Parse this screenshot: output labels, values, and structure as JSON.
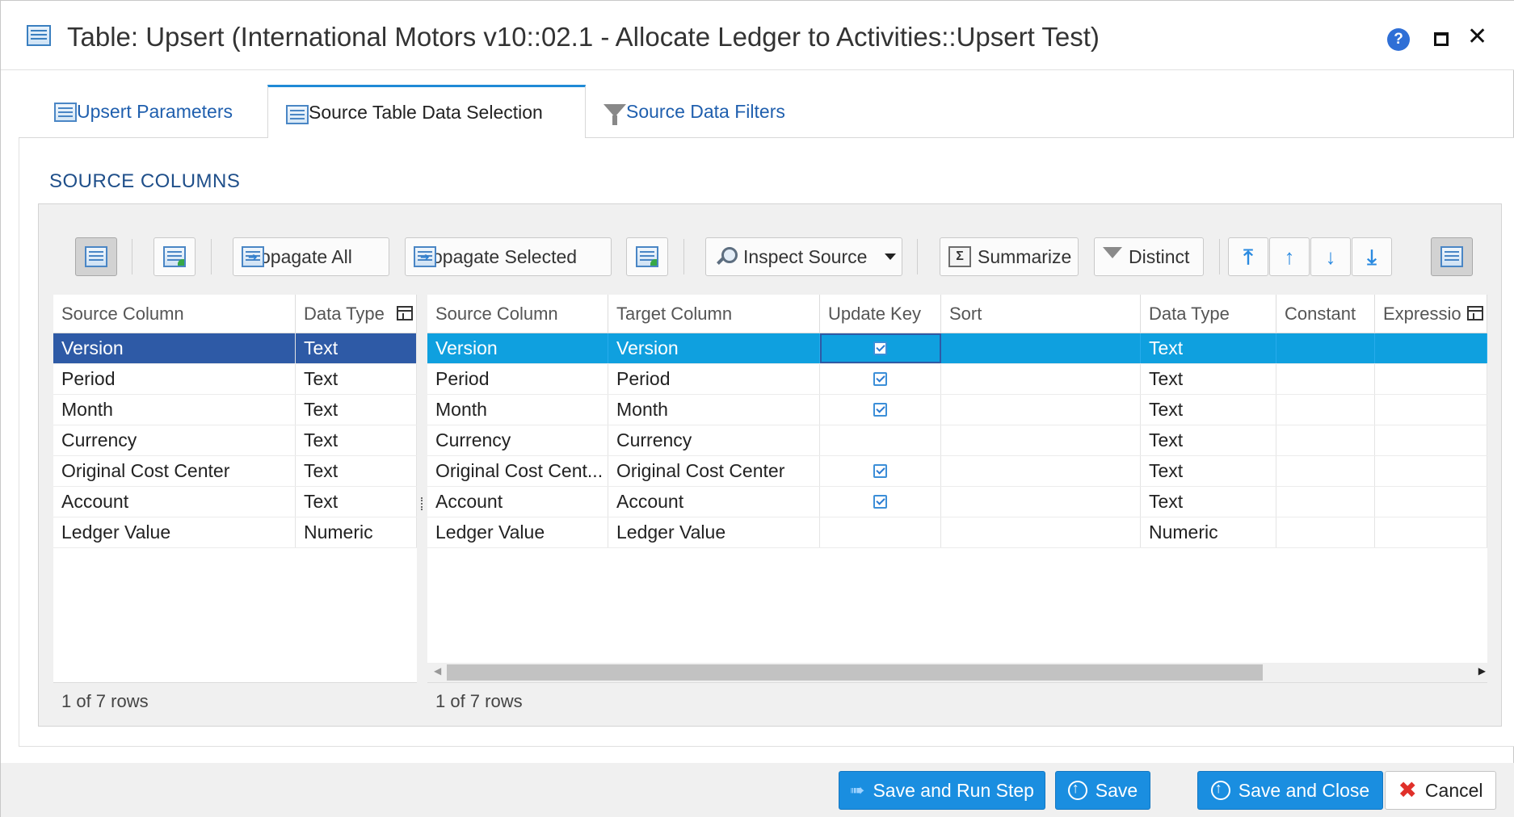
{
  "window": {
    "title": "Table: Upsert (International Motors v10::02.1 - Allocate Ledger to Activities::Upsert Test)",
    "icons": {
      "app": "table-icon",
      "help": "help-icon",
      "maximize": "maximize-icon",
      "close": "close-icon"
    },
    "help_glyph": "?",
    "close_glyph": "✕"
  },
  "tabs": [
    {
      "label": "Upsert Parameters",
      "icon": "grid-icon",
      "active": false
    },
    {
      "label": "Source Table Data Selection",
      "icon": "grid-icon",
      "active": true
    },
    {
      "label": "Source Data Filters",
      "icon": "funnel-icon",
      "active": false
    }
  ],
  "section_title": "SOURCE COLUMNS",
  "toolbar": {
    "propagate_all": "Propagate All",
    "propagate_selected": "Propagate Selected",
    "inspect_source": "Inspect Source",
    "summarize": "Summarize",
    "distinct": "Distinct",
    "sigma_glyph": "Σ",
    "move_top_glyph": "⤒",
    "move_up_glyph": "↑",
    "move_down_glyph": "↓",
    "move_bottom_glyph": "⤓"
  },
  "left_grid": {
    "columns": [
      "Source Column",
      "Data Type"
    ],
    "rows": [
      [
        "Version",
        "Text"
      ],
      [
        "Period",
        "Text"
      ],
      [
        "Month",
        "Text"
      ],
      [
        "Currency",
        "Text"
      ],
      [
        "Original Cost Center",
        "Text"
      ],
      [
        "Account",
        "Text"
      ],
      [
        "Ledger Value",
        "Numeric"
      ]
    ],
    "footer": "1 of 7 rows"
  },
  "right_grid": {
    "columns": [
      "Source Column",
      "Target Column",
      "Update Key",
      "Sort",
      "Data Type",
      "Constant",
      "Expressio"
    ],
    "rows": [
      {
        "source": "Version",
        "target": "Version",
        "update_key": true,
        "sort": "",
        "type": "Text",
        "constant": "",
        "expression": ""
      },
      {
        "source": "Period",
        "target": "Period",
        "update_key": true,
        "sort": "",
        "type": "Text",
        "constant": "",
        "expression": ""
      },
      {
        "source": "Month",
        "target": "Month",
        "update_key": true,
        "sort": "",
        "type": "Text",
        "constant": "",
        "expression": ""
      },
      {
        "source": "Currency",
        "target": "Currency",
        "update_key": false,
        "sort": "",
        "type": "Text",
        "constant": "",
        "expression": ""
      },
      {
        "source": "Original Cost Cent...",
        "target": "Original Cost Center",
        "update_key": true,
        "sort": "",
        "type": "Text",
        "constant": "",
        "expression": ""
      },
      {
        "source": "Account",
        "target": "Account",
        "update_key": true,
        "sort": "",
        "type": "Text",
        "constant": "",
        "expression": ""
      },
      {
        "source": "Ledger Value",
        "target": "Ledger Value",
        "update_key": false,
        "sort": "",
        "type": "Numeric",
        "constant": "",
        "expression": ""
      }
    ],
    "footer": "1 of 7 rows"
  },
  "buttons": {
    "save_and_run": "Save and Run Step",
    "save": "Save",
    "save_and_close": "Save and Close",
    "cancel": "Cancel"
  },
  "colors": {
    "accent": "#1a8ee0",
    "left_selection": "#2e5aa6",
    "right_selection": "#0fa0df",
    "link_blue": "#1f5fae"
  }
}
